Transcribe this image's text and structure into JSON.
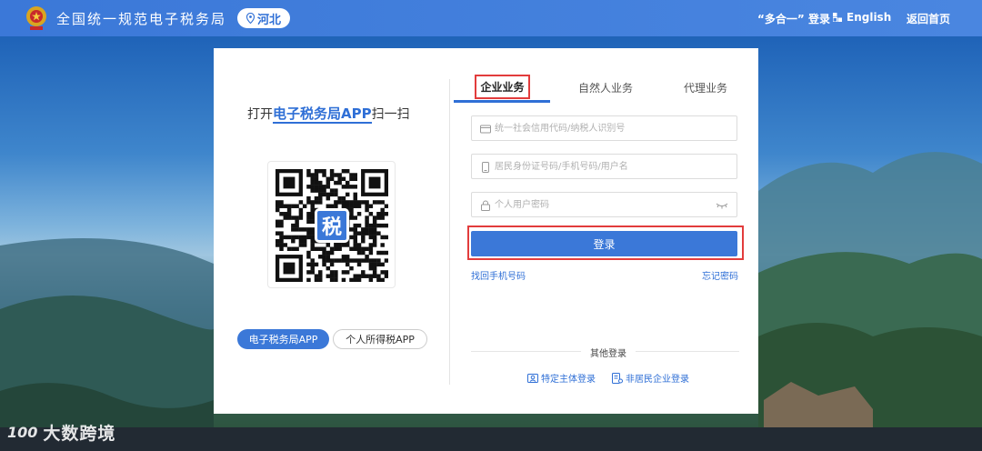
{
  "header": {
    "site_title": "全国统一规范电子税务局",
    "region": "河北",
    "links": {
      "unified_login": "“多合一” 登录",
      "english": "English",
      "home": "返回首页"
    }
  },
  "left_panel": {
    "scan_prefix": "打开",
    "scan_app": "电子税务局APP",
    "scan_suffix": "扫一扫",
    "qr_logo": "税",
    "buttons": {
      "tax_app": "电子税务局APP",
      "iit_app": "个人所得税APP"
    }
  },
  "tabs": [
    {
      "label": "企业业务",
      "active": true
    },
    {
      "label": "自然人业务",
      "active": false
    },
    {
      "label": "代理业务",
      "active": false
    }
  ],
  "form": {
    "credit_code_placeholder": "统一社会信用代码/纳税人识别号",
    "account_placeholder": "居民身份证号码/手机号码/用户名",
    "password_placeholder": "个人用户密码",
    "login_label": "登录",
    "find_phone": "找回手机号码",
    "forgot_password": "忘记密码"
  },
  "other_login": {
    "label": "其他登录",
    "specific_entity": "特定主体登录",
    "non_resident": "非居民企业登录"
  },
  "watermark": {
    "logo": "100",
    "text": "大数跨境"
  },
  "colors": {
    "brand": "#3b78d8",
    "highlight_frame": "#e23c3c",
    "link": "#2f6fd6"
  }
}
